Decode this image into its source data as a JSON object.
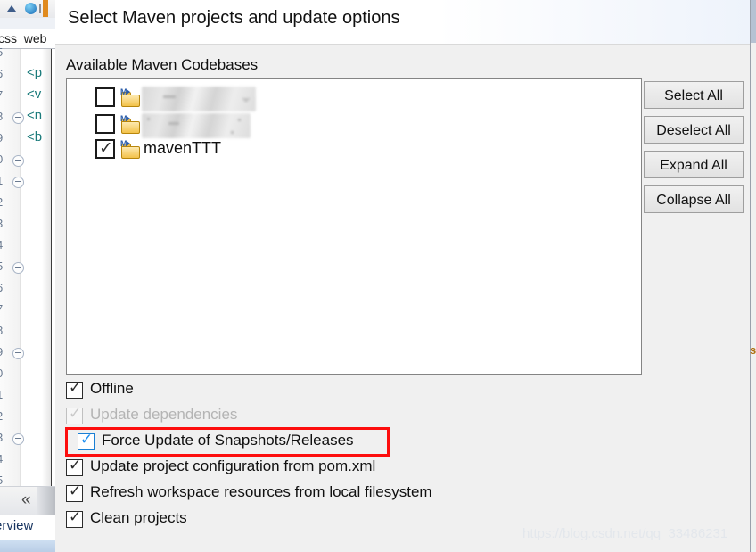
{
  "dialog": {
    "title": "Select Maven projects and update options",
    "group_label": "Available Maven Codebases",
    "tree_items": [
      {
        "label": "",
        "redacted": true,
        "checked": false
      },
      {
        "label": "",
        "redacted": true,
        "checked": false
      },
      {
        "label": "mavenTTT",
        "redacted": false,
        "checked": true
      }
    ],
    "side_buttons": [
      {
        "label": "Select All"
      },
      {
        "label": "Deselect All"
      },
      {
        "label": "Expand All"
      },
      {
        "label": "Collapse All"
      }
    ],
    "options": [
      {
        "label": "Offline",
        "checked": true,
        "enabled": true,
        "focused": false,
        "highlighted": false
      },
      {
        "label": "Update dependencies",
        "checked": true,
        "enabled": false,
        "focused": false,
        "highlighted": false
      },
      {
        "label": "Force Update of Snapshots/Releases",
        "checked": true,
        "enabled": true,
        "focused": true,
        "highlighted": true
      },
      {
        "label": "Update project configuration from pom.xml",
        "checked": true,
        "enabled": true,
        "focused": false,
        "highlighted": false
      },
      {
        "label": "Refresh workspace resources from local filesystem",
        "checked": true,
        "enabled": true,
        "focused": false,
        "highlighted": false
      },
      {
        "label": "Clean projects",
        "checked": true,
        "enabled": true,
        "focused": false,
        "highlighted": false
      }
    ],
    "highlight_color": "#fd0d0d"
  },
  "watermark": {
    "text": "https://blog.csdn.net/qq_33486231"
  },
  "ide": {
    "editor_tab_label": "css_web",
    "bottom_tab_label": "erview",
    "scroll_left_glyph": "«",
    "line_numbers": [
      "5",
      "6",
      "7",
      "8",
      "9",
      "0",
      "1",
      "2",
      "3",
      "4",
      "5",
      "6",
      "7",
      "8",
      "9",
      "0",
      "1",
      "2",
      "3",
      "4",
      "5"
    ],
    "code_lines": [
      "<p",
      "<v",
      "<n",
      "<b"
    ],
    "status_fragment": "s"
  }
}
